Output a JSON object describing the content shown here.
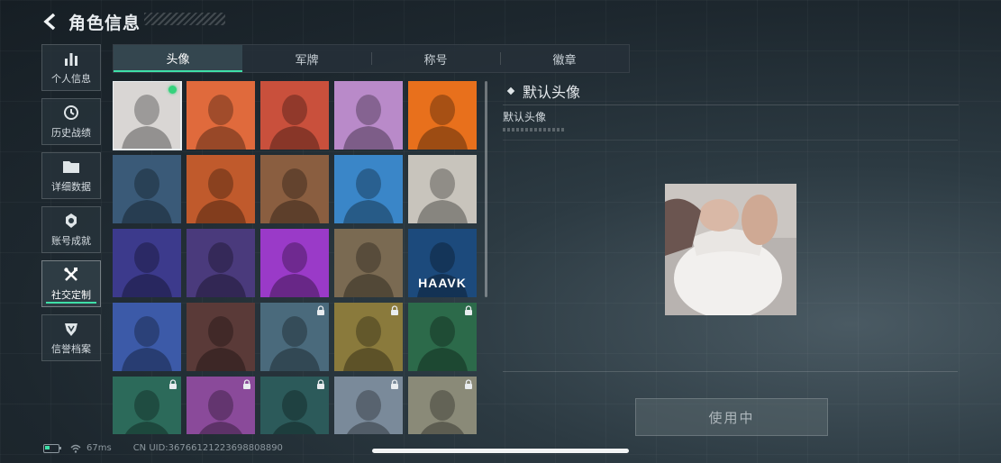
{
  "header": {
    "title": "角色信息",
    "back_icon": "chevron-left-icon"
  },
  "sidebar": {
    "items": [
      {
        "label": "个人信息",
        "icon": "bar-chart-icon",
        "active": false
      },
      {
        "label": "历史战绩",
        "icon": "clock-icon",
        "active": false
      },
      {
        "label": "详细数据",
        "icon": "folder-icon",
        "active": false
      },
      {
        "label": "账号成就",
        "icon": "medal-icon",
        "active": false
      },
      {
        "label": "社交定制",
        "icon": "tools-icon",
        "active": true
      },
      {
        "label": "信誉档案",
        "icon": "shield-icon",
        "active": false
      }
    ]
  },
  "tabs": [
    {
      "label": "头像",
      "active": true
    },
    {
      "label": "军牌",
      "active": false
    },
    {
      "label": "称号",
      "active": false
    },
    {
      "label": "徽章",
      "active": false
    }
  ],
  "avatars": [
    {
      "name": "default-avatar",
      "selected": true,
      "locked": false,
      "color": "#d9d6d4"
    },
    {
      "name": "operator-cap",
      "locked": false,
      "color": "#e06a3c"
    },
    {
      "name": "operator-helmet",
      "locked": false,
      "color": "#c9503c"
    },
    {
      "name": "white-hair",
      "locked": false,
      "color": "#b98ac9"
    },
    {
      "name": "masked-operator",
      "locked": false,
      "color": "#e8701c"
    },
    {
      "name": "sniper-rifle",
      "locked": false,
      "color": "#3a5a78"
    },
    {
      "name": "feather",
      "locked": false,
      "color": "#c05a2c"
    },
    {
      "name": "scales",
      "locked": false,
      "color": "#8a5e40"
    },
    {
      "name": "monkey-book",
      "locked": false,
      "color": "#3a86c8"
    },
    {
      "name": "eagle-emblem-light",
      "locked": false,
      "color": "#c8c4bc"
    },
    {
      "name": "fireworks-2026",
      "locked": false,
      "color": "#3c3a8c"
    },
    {
      "name": "glasses-man",
      "locked": false,
      "color": "#4a3a7c"
    },
    {
      "name": "goggles-girl",
      "locked": false,
      "color": "#9a3ac8"
    },
    {
      "name": "eagle-emblem-camo",
      "locked": false,
      "color": "#7a6a52"
    },
    {
      "name": "haavk-logo",
      "locked": false,
      "color": "#1c4a7c",
      "text": "HAAVK"
    },
    {
      "name": "tribal-mask",
      "locked": false,
      "color": "#3c5aa8"
    },
    {
      "name": "skull-mask",
      "locked": false,
      "color": "#5a3a38"
    },
    {
      "name": "pilot-woman",
      "locked": true,
      "color": "#4a6a7c"
    },
    {
      "name": "bearded-soldier",
      "locked": true,
      "color": "#8a7a3c"
    },
    {
      "name": "headset-man",
      "locked": true,
      "color": "#2c6a4a"
    },
    {
      "name": "bearded-glasses",
      "locked": true,
      "color": "#2c6a5a"
    },
    {
      "name": "purple-girl",
      "locked": true,
      "color": "#8a4a9a"
    },
    {
      "name": "helmet-soldier",
      "locked": true,
      "color": "#2c5a5a"
    },
    {
      "name": "star-emblem",
      "locked": true,
      "color": "#7a8a9a"
    },
    {
      "name": "helicopter-scene",
      "locked": true,
      "color": "#8a8a78"
    }
  ],
  "detail": {
    "heading": "默认头像",
    "description": "默认头像"
  },
  "use_button": {
    "label": "使用中"
  },
  "status": {
    "ping": "67ms",
    "uid": "CN UID:36766121223698808890"
  },
  "colors": {
    "accent": "#3fe0a8",
    "selected_dot": "#34d27c"
  }
}
